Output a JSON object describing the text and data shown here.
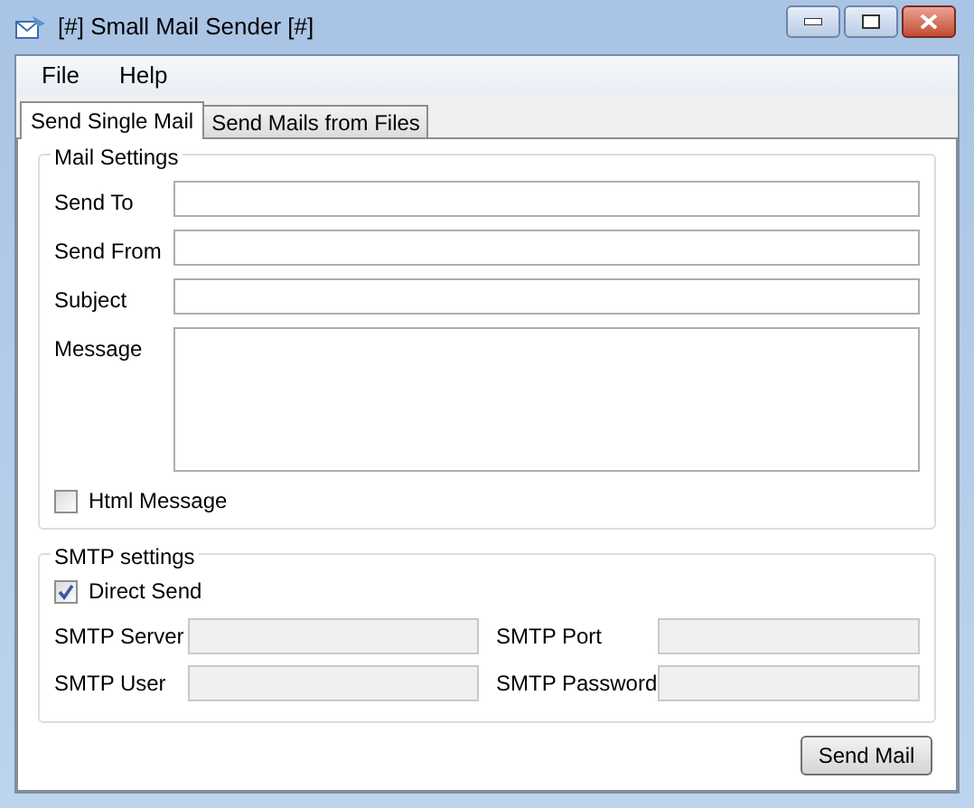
{
  "window": {
    "title": "[#] Small Mail Sender [#]"
  },
  "menu": [
    "File",
    "Help"
  ],
  "tabs": [
    {
      "label": "Send Single Mail",
      "selected": true
    },
    {
      "label": "Send Mails from Files",
      "selected": false
    }
  ],
  "mail_settings": {
    "title": "Mail Settings",
    "fields": [
      {
        "label": "Send To",
        "kind": "line"
      },
      {
        "label": "Send From",
        "kind": "line"
      },
      {
        "label": "Subject",
        "kind": "line"
      },
      {
        "label": "Message",
        "kind": "area"
      }
    ],
    "html_message": {
      "label": "Html Message",
      "checked": false
    }
  },
  "smtp_settings": {
    "title": "SMTP settings",
    "direct_send": {
      "label": "Direct Send",
      "checked": true
    },
    "fields": [
      {
        "label": "SMTP Server",
        "disabled": true
      },
      {
        "label": "SMTP Port",
        "disabled": true
      },
      {
        "label": "SMTP User",
        "disabled": true
      },
      {
        "label": "SMTP Password",
        "disabled": true
      }
    ]
  },
  "send_button": "Send Mail"
}
